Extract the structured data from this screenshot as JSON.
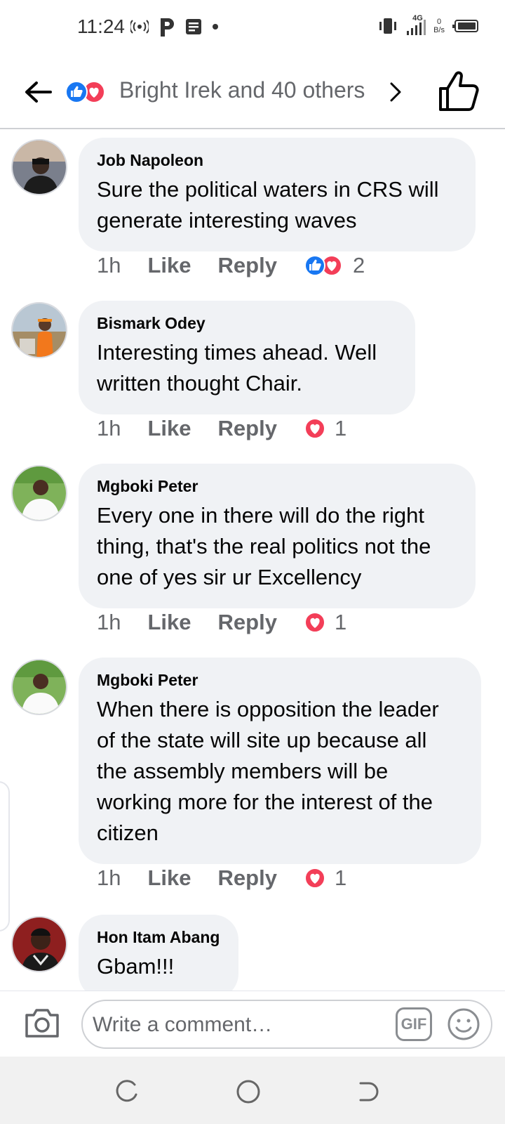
{
  "status_bar": {
    "time": "11:24",
    "network_type": "4G",
    "data_speed_value": "0",
    "data_speed_unit": "B/s"
  },
  "header": {
    "reactors_text": "Bright Irek and 40 others",
    "icons": [
      "back-arrow-icon",
      "like-reaction-icon",
      "love-reaction-icon",
      "chevron-right-icon",
      "thumbs-up-outline-icon"
    ]
  },
  "comments": [
    {
      "author": "Job Napoleon",
      "text": "Sure the political waters in CRS will generate interesting waves",
      "time": "1h",
      "like_label": "Like",
      "reply_label": "Reply",
      "reactions": [
        "like",
        "love"
      ],
      "reaction_count": "2"
    },
    {
      "author": "Bismark Odey",
      "text": "Interesting times ahead. Well written thought Chair.",
      "time": "1h",
      "like_label": "Like",
      "reply_label": "Reply",
      "reactions": [
        "love"
      ],
      "reaction_count": "1"
    },
    {
      "author": "Mgboki Peter",
      "text": "Every one in there will do the right thing, that's the real politics not the one of yes sir ur Excellency",
      "time": "1h",
      "like_label": "Like",
      "reply_label": "Reply",
      "reactions": [
        "love"
      ],
      "reaction_count": "1"
    },
    {
      "author": "Mgboki Peter",
      "text": "When there is opposition the leader of the state will site up because all the assembly members will be working more for the interest of the citizen",
      "time": "1h",
      "like_label": "Like",
      "reply_label": "Reply",
      "reactions": [
        "love"
      ],
      "reaction_count": "1"
    },
    {
      "author": "Hon Itam Abang",
      "text": "Gbam!!!"
    }
  ],
  "composer": {
    "placeholder": "Write a comment…",
    "gif_label": "GIF"
  },
  "colors": {
    "like_blue": "#1877f2",
    "love_red": "#f33e58",
    "bubble_bg": "#f0f2f5",
    "secondary_text": "#65676b"
  }
}
